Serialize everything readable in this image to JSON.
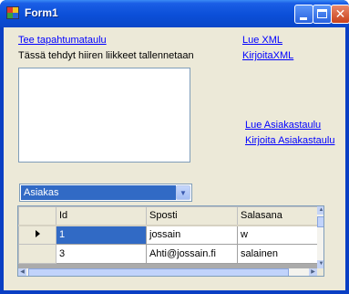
{
  "window": {
    "title": "Form1",
    "icons": {
      "app": "form-icon",
      "minimize": "minimize-icon",
      "maximize": "maximize-icon",
      "close": "close-icon"
    }
  },
  "links": {
    "tee_tapahtumataulu": "Tee tapahtumataulu",
    "lue_xml": "Lue XML",
    "kirjoita_xml": "KirjoitaXML",
    "lue_asiakastaulu": "Lue Asiakastaulu",
    "kirjoita_asiakastaulu": "Kirjoita Asiakastaulu"
  },
  "mouse_label": "Tässä tehdyt hiiren liikkeet tallennetaan",
  "textbox": {
    "value": ""
  },
  "combo": {
    "selected": "Asiakas"
  },
  "grid": {
    "columns": [
      "Id",
      "Sposti",
      "Salasana"
    ],
    "rows": [
      {
        "id": "1",
        "sposti": "jossain",
        "salasana": "w",
        "current": true
      },
      {
        "id": "3",
        "sposti": "Ahti@jossain.fi",
        "salasana": "salainen",
        "current": false
      }
    ]
  },
  "colors": {
    "link": "#0000ff",
    "selection": "#316ac5",
    "client_bg": "#ece9d8",
    "titlebar": "#0b4fd8"
  }
}
